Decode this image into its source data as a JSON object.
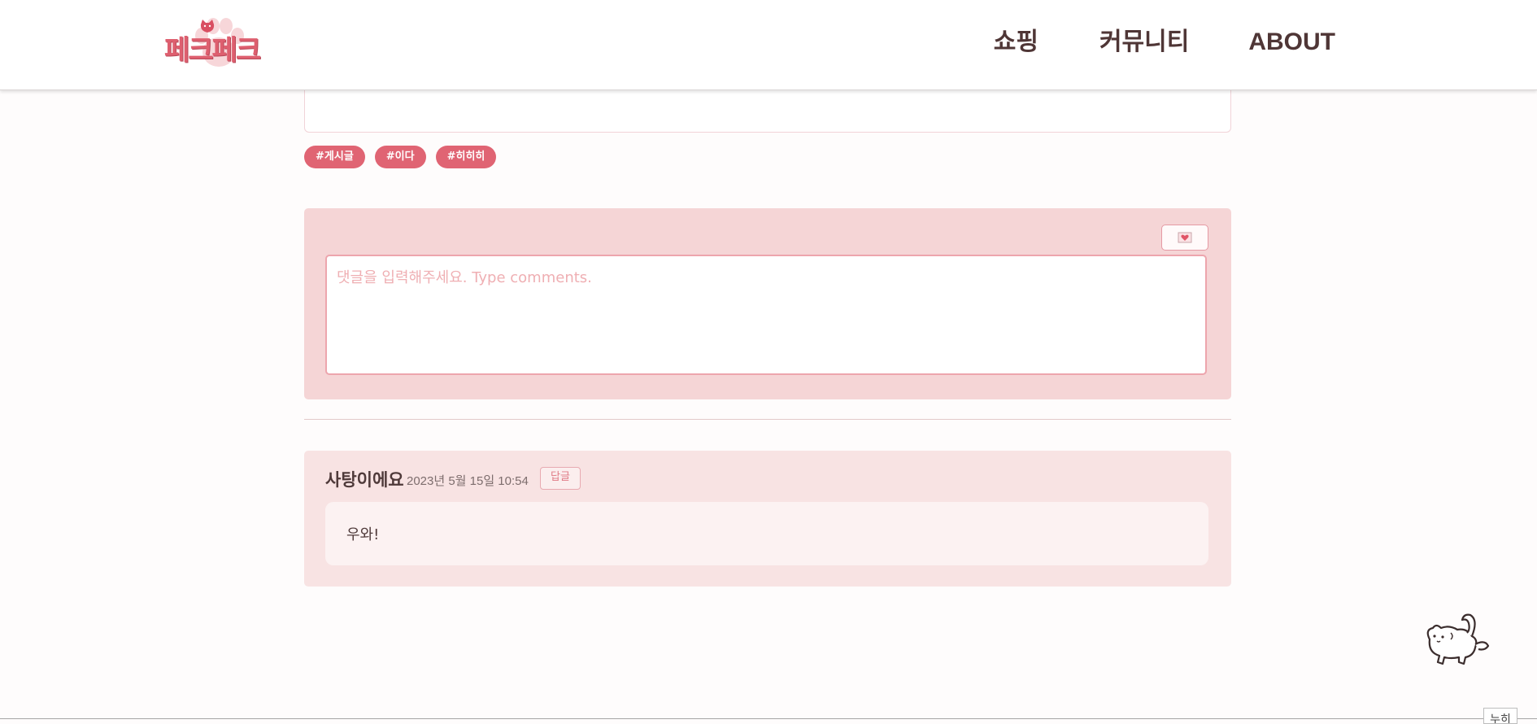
{
  "header": {
    "logo_text": "페크페크",
    "nav": [
      "쇼핑",
      "커뮤니티",
      "ABOUT"
    ]
  },
  "post": {
    "tags": [
      "#게시글",
      "#이다",
      "#히히히"
    ]
  },
  "comment_form": {
    "placeholder": "댓글을 입력해주세요. Type comments.",
    "submit_icon": "heart-envelope-icon"
  },
  "comments": [
    {
      "author": "사탕이에요",
      "date": "2023년 5월 15일 10:54",
      "reply_label": "답글",
      "text": "우와!"
    }
  ],
  "footer": {
    "top_button_label": "누히"
  },
  "colors": {
    "brand": "#de5f6f",
    "tag_bg": "#e06473",
    "form_bg": "#f5d5d6",
    "comment_bg": "#f8e3e3",
    "text_dark": "#4f3636"
  }
}
